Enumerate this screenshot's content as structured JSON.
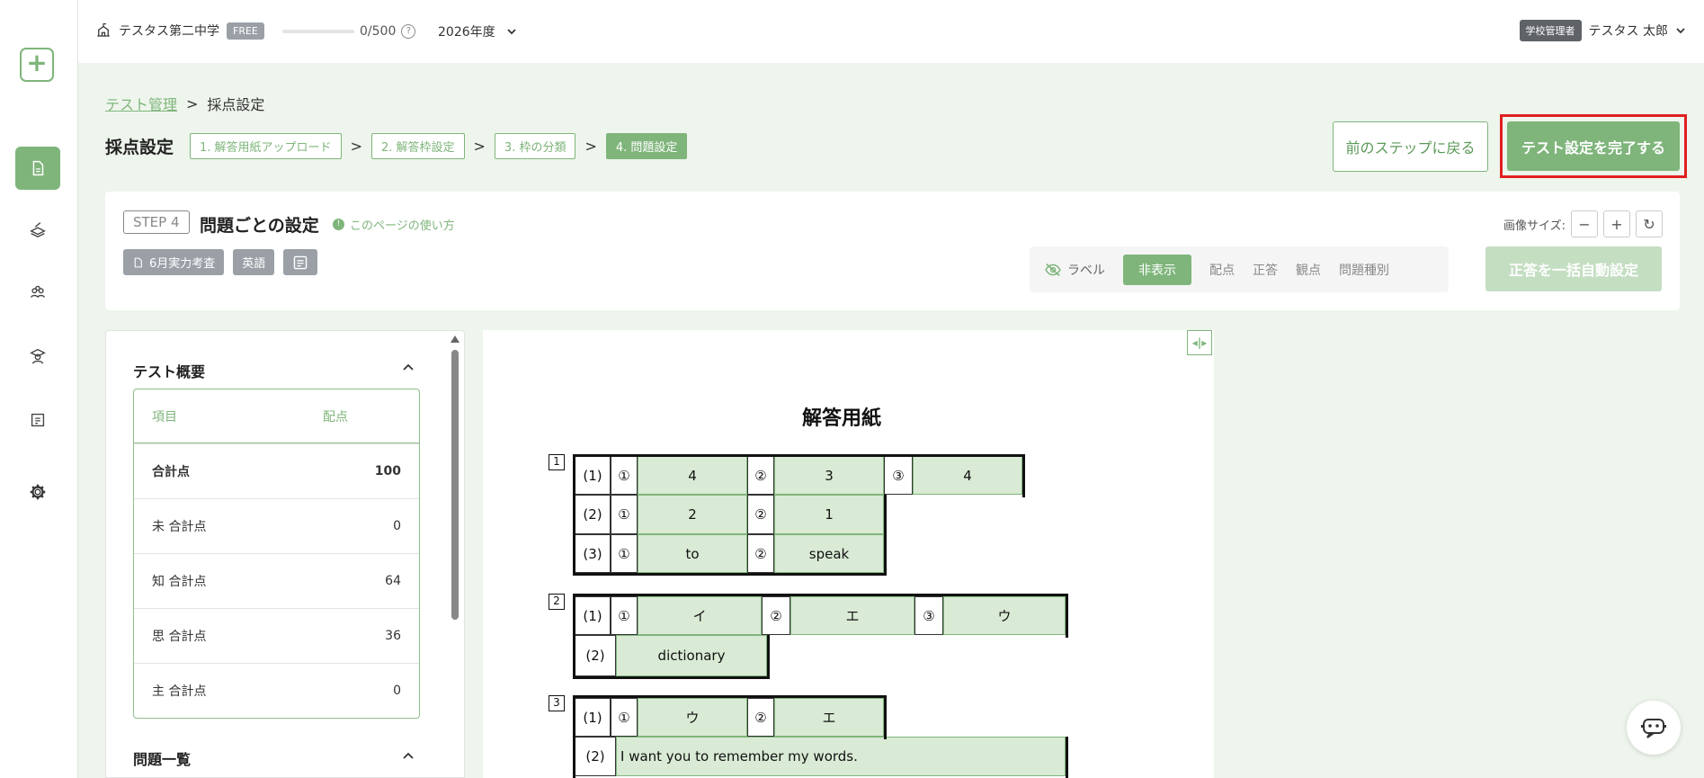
{
  "sidebar": {
    "logo_symbol": "+",
    "items": [
      {
        "icon": "document-icon",
        "active": true
      },
      {
        "icon": "scanner-icon",
        "active": false
      },
      {
        "icon": "people-icon",
        "active": false
      },
      {
        "icon": "student-icon",
        "active": false
      },
      {
        "icon": "roster-icon",
        "active": false
      },
      {
        "icon": "gear-icon",
        "active": false
      }
    ]
  },
  "topbar": {
    "school_name": "テスタス第二中学",
    "plan_badge": "FREE",
    "quota_text": "0/500",
    "quota_fraction": 0,
    "help_symbol": "?",
    "year": "2026年度",
    "role_badge": "学校管理者",
    "user_name": "テスタス 太郎"
  },
  "breadcrumb": {
    "parent": "テスト管理",
    "separator": ">",
    "current": "採点設定"
  },
  "header": {
    "title": "採点設定",
    "steps": [
      {
        "label": "1. 解答用紙アップロード",
        "active": false
      },
      {
        "label": "2. 解答枠設定",
        "active": false
      },
      {
        "label": "3. 枠の分類",
        "active": false
      },
      {
        "label": "4. 問題設定",
        "active": true
      }
    ],
    "chevron": ">",
    "prev_button": "前のステップに戻る",
    "complete_button": "テスト設定を完了する"
  },
  "step_panel": {
    "step_tag": "STEP 4",
    "title": "問題ごとの設定",
    "howto": "このページの使い方",
    "howto_symbol": "!",
    "chips": {
      "test_name": "6月実力考査",
      "subject": "英語"
    },
    "image_size_label": "画像サイズ:",
    "zoom_out": "−",
    "zoom_in": "+",
    "reset": "↻",
    "label_toggle": "ラベル",
    "label_options": [
      {
        "label": "非表示",
        "active": true
      },
      {
        "label": "配点",
        "active": false
      },
      {
        "label": "正答",
        "active": false
      },
      {
        "label": "観点",
        "active": false
      },
      {
        "label": "問題種別",
        "active": false
      }
    ],
    "auto_button": "正答を一括自動設定"
  },
  "overview": {
    "title": "テスト概要",
    "table_headers": [
      "項目",
      "配点"
    ],
    "rows": [
      {
        "label": "合計点",
        "value": "100",
        "bold": true
      },
      {
        "label": "未 合計点",
        "value": "0",
        "bold": false
      },
      {
        "label": "知 合計点",
        "value": "64",
        "bold": false
      },
      {
        "label": "思 合計点",
        "value": "36",
        "bold": false
      },
      {
        "label": "主 合計点",
        "value": "0",
        "bold": false
      }
    ],
    "list_title": "問題一覧",
    "collapse_symbol": "^"
  },
  "sheet": {
    "expand_symbol": "◂|▸",
    "title": "解答用紙",
    "sections": [
      {
        "number": "1",
        "rows": [
          {
            "label": "(1)",
            "answers": [
              {
                "mark": "①",
                "text": "4"
              },
              {
                "mark": "②",
                "text": "3"
              },
              {
                "mark": "③",
                "text": "4"
              }
            ]
          },
          {
            "label": "(2)",
            "answers": [
              {
                "mark": "①",
                "text": "2"
              },
              {
                "mark": "②",
                "text": "1"
              }
            ]
          },
          {
            "label": "(3)",
            "answers": [
              {
                "mark": "①",
                "text": "to"
              },
              {
                "mark": "②",
                "text": "speak"
              }
            ]
          }
        ]
      },
      {
        "number": "2",
        "rows": [
          {
            "label": "(1)",
            "answers": [
              {
                "mark": "①",
                "text": "イ"
              },
              {
                "mark": "②",
                "text": "エ"
              },
              {
                "mark": "③",
                "text": "ウ"
              }
            ]
          },
          {
            "label": "(2)",
            "answers": [
              {
                "mark": "",
                "text": "dictionary"
              }
            ]
          }
        ]
      },
      {
        "number": "3",
        "rows": [
          {
            "label": "(1)",
            "answers": [
              {
                "mark": "①",
                "text": "ウ"
              },
              {
                "mark": "②",
                "text": "エ"
              }
            ]
          },
          {
            "label": "(2)",
            "answers": [
              {
                "mark": "",
                "text": "I want you to remember my words."
              }
            ]
          }
        ]
      }
    ]
  },
  "colors": {
    "accent": "#7fb57b",
    "accent_light": "#d9ead5",
    "highlight": "#e02020",
    "background": "#eef5ec"
  }
}
